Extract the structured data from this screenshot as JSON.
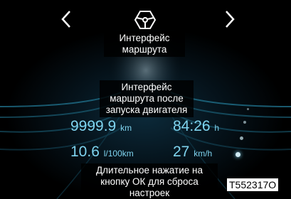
{
  "navigation": {
    "prev_icon": "chevron-left-icon",
    "next_icon": "chevron-right-icon",
    "center_icon": "steering-wheel-icon"
  },
  "labels": {
    "top": "Интерфейс маршрута",
    "middle": "Интерфейс маршрута после запуска двигателя",
    "bottom": "Длительное нажатие на кнопку ОК для сброса настроек"
  },
  "metrics": {
    "distance": {
      "value": "9999.9",
      "unit": "km"
    },
    "time": {
      "value": "84:26",
      "unit": "h"
    },
    "consumption": {
      "value": "10.6",
      "unit": "l/100km"
    },
    "speed": {
      "value": "27",
      "unit": "km/h"
    }
  },
  "figure_code": "T552317O",
  "colors": {
    "accent": "#7fd4ef",
    "background": "#000000"
  }
}
